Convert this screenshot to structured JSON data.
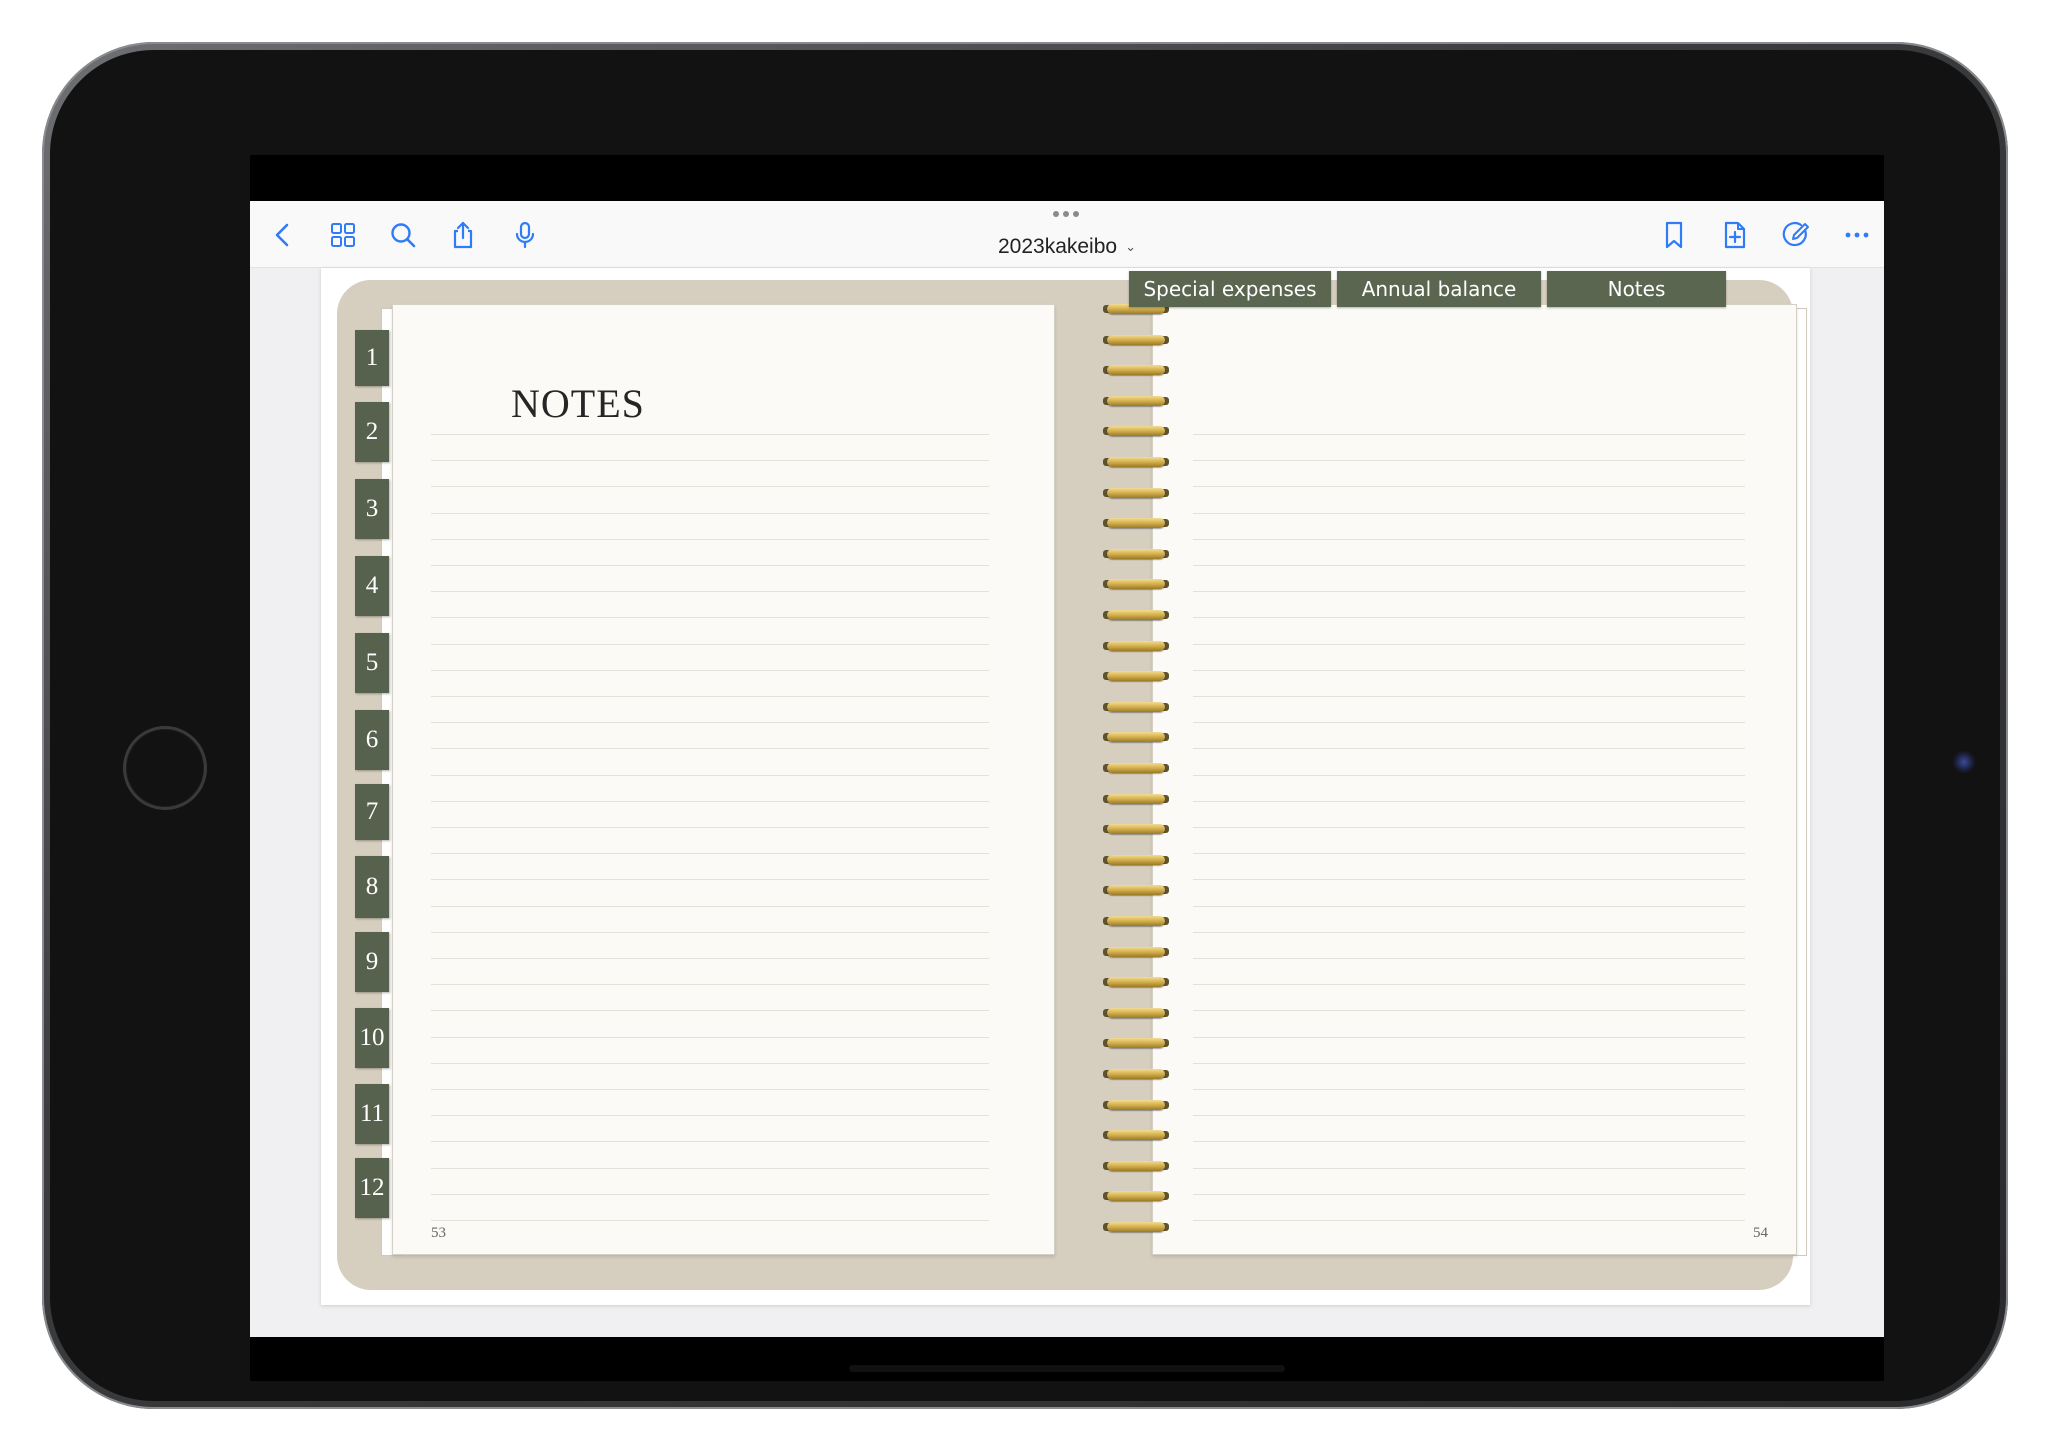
{
  "toolbar": {
    "title": "2023kakeibo",
    "title_chevron": "⌄"
  },
  "top_tabs": [
    "Special expenses",
    "Annual balance",
    "Notes"
  ],
  "month_tabs": [
    "1",
    "2",
    "3",
    "4",
    "5",
    "6",
    "7",
    "8",
    "9",
    "10",
    "11",
    "12"
  ],
  "left_page": {
    "heading": "NOTES",
    "page_number": "53"
  },
  "right_page": {
    "page_number": "54"
  },
  "colors": {
    "accent": "#2f7cf6",
    "tab_green": "#56624e",
    "binder": "#d6cebf"
  }
}
